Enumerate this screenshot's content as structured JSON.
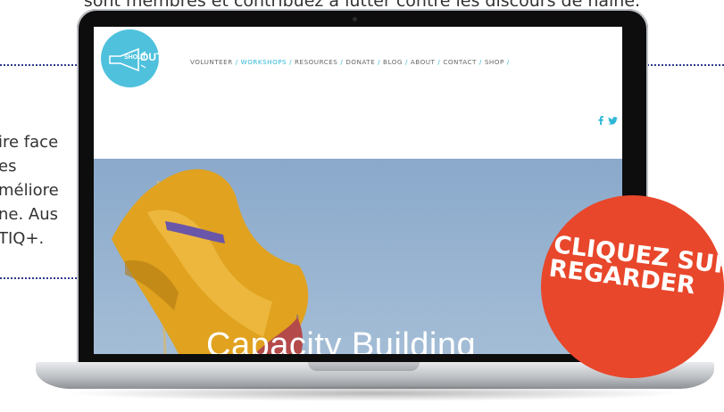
{
  "background": {
    "top_line": "sont membres et contribuez à lutter contre les discours de haine.",
    "left_fragments": [
      "ire face",
      "es",
      "méliore",
      "ne. Aus",
      "TIQ+."
    ]
  },
  "site": {
    "logo": {
      "small": "SHOUT",
      "big": "OUT"
    },
    "nav": [
      {
        "label": "VOLUNTEER"
      },
      {
        "label": "WORKSHOPS",
        "active": true
      },
      {
        "label": "RESOURCES"
      },
      {
        "label": "DONATE"
      },
      {
        "label": "BLOG"
      },
      {
        "label": "ABOUT"
      },
      {
        "label": "CONTACT"
      },
      {
        "label": "SHOP"
      }
    ],
    "nav_separator": "/",
    "social_icons": [
      "facebook-icon",
      "twitter-icon"
    ],
    "hero_title": "Capacity Building"
  },
  "cta": {
    "line1": "CLIQUEZ SUR",
    "line2": "REGARDER"
  },
  "colors": {
    "accent": "#2fb7d8",
    "logo_bg": "#4fc1dd",
    "cta_bg": "#e8472b",
    "hero_sky": "#8aa9cb"
  }
}
